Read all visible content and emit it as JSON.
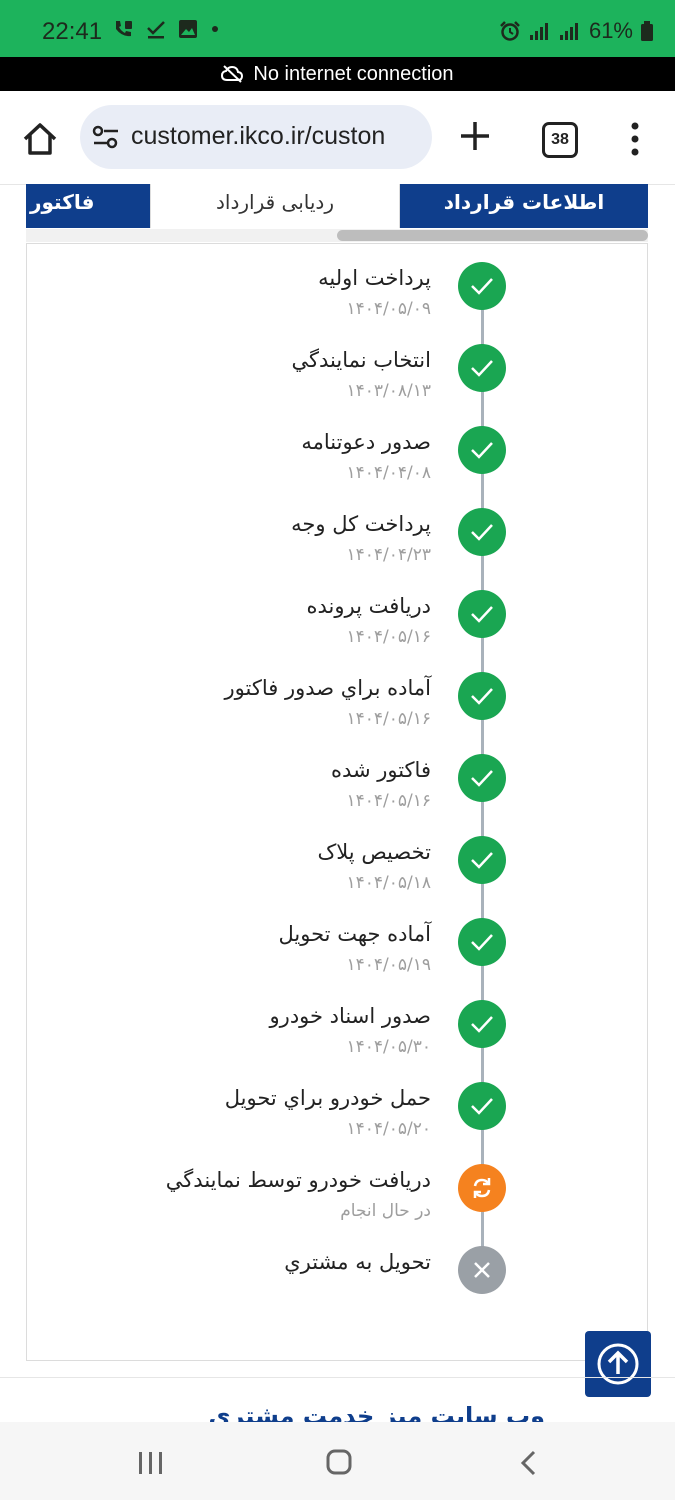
{
  "status_bar": {
    "time": "22:41",
    "battery": "61%",
    "icons_left": [
      "wifi-calling-icon",
      "check-icon",
      "image-icon",
      "dot-icon"
    ],
    "icons_right": [
      "alarm-icon",
      "signal-icon",
      "signal-icon",
      "battery-icon"
    ]
  },
  "network_banner": {
    "text": "No internet connection",
    "icon": "cloud-off-icon"
  },
  "browser": {
    "url": "customer.ikco.ir/custon",
    "tab_count": "38"
  },
  "tabs": [
    {
      "label": "اطلاعات قرارداد",
      "active": false
    },
    {
      "label": "ردیابی قرارداد",
      "active": true
    },
    {
      "label": "فاکتور",
      "active": false
    }
  ],
  "steps": [
    {
      "label": "پرداخت اوليه",
      "date": "۱۴۰۴/۰۵/۰۹",
      "status": "done"
    },
    {
      "label": "انتخاب نمايندگي",
      "date": "۱۴۰۳/۰۸/۱۳",
      "status": "done"
    },
    {
      "label": "صدور دعوتنامه",
      "date": "۱۴۰۴/۰۴/۰۸",
      "status": "done"
    },
    {
      "label": "پرداخت کل وجه",
      "date": "۱۴۰۴/۰۴/۲۳",
      "status": "done"
    },
    {
      "label": "دريافت پرونده",
      "date": "۱۴۰۴/۰۵/۱۶",
      "status": "done"
    },
    {
      "label": "آماده براي صدور فاکتور",
      "date": "۱۴۰۴/۰۵/۱۶",
      "status": "done"
    },
    {
      "label": "فاکتور شده",
      "date": "۱۴۰۴/۰۵/۱۶",
      "status": "done"
    },
    {
      "label": "تخصيص پلاک",
      "date": "۱۴۰۴/۰۵/۱۸",
      "status": "done"
    },
    {
      "label": "آماده جهت تحويل",
      "date": "۱۴۰۴/۰۵/۱۹",
      "status": "done"
    },
    {
      "label": "صدور اسناد خودرو",
      "date": "۱۴۰۴/۰۵/۳۰",
      "status": "done"
    },
    {
      "label": "حمل خودرو براي تحويل",
      "date": "۱۴۰۴/۰۵/۲۰",
      "status": "done"
    },
    {
      "label": "دريافت خودرو توسط نمايندگي",
      "date": "در حال انجام",
      "status": "in-progress"
    },
    {
      "label": "تحويل به مشتري",
      "date": "",
      "status": "pending"
    }
  ],
  "footer": {
    "title": "وب سایت میز خدمت مشتری"
  },
  "colors": {
    "status_bar": "#1db35c",
    "primary": "#0f3e8c",
    "done": "#1aa652",
    "in_progress": "#f5821f",
    "pending": "#9aa0a6"
  }
}
